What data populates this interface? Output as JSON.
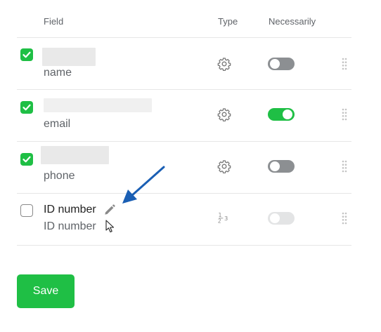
{
  "table": {
    "headers": {
      "field": "Field",
      "type": "Type",
      "necessarily": "Necessarily"
    },
    "rows": [
      {
        "label": "name",
        "checked": true,
        "type_icon": "gear-icon",
        "required": "off"
      },
      {
        "label": "email",
        "checked": true,
        "type_icon": "gear-icon",
        "required": "on"
      },
      {
        "label": "phone",
        "checked": true,
        "type_icon": "gear-icon",
        "required": "off"
      },
      {
        "title": "ID number",
        "label": "ID number",
        "checked": false,
        "type_icon": "number-type-icon",
        "required": "disabled"
      }
    ]
  },
  "save_label": "Save",
  "colors": {
    "accent": "#1fbf45",
    "annotation_arrow": "#1a5fb4"
  }
}
